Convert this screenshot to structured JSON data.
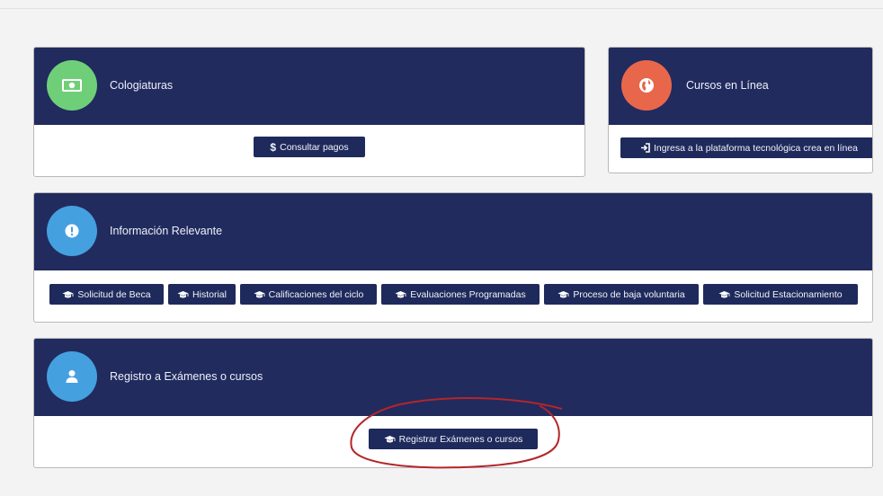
{
  "cards": {
    "colegiaturas": {
      "title": "Cologiaturas",
      "icon": "money-icon",
      "icon_color": "#6fcf78",
      "button": {
        "label": "Consultar pagos",
        "icon": "dollar-icon"
      }
    },
    "cursos": {
      "title": "Cursos en Línea",
      "icon": "globe-icon",
      "icon_color": "#e8674b",
      "button": {
        "label": "Ingresa a la plataforma tecnológica crea en línea",
        "icon": "sign-in-icon"
      }
    },
    "informacion": {
      "title": "Información Relevante",
      "icon": "exclamation-icon",
      "icon_color": "#45a0e0",
      "buttons": [
        {
          "label": "Solicitud de Beca",
          "icon": "graduation-cap-icon"
        },
        {
          "label": "Historial",
          "icon": "graduation-cap-icon"
        },
        {
          "label": "Calificaciones del ciclo",
          "icon": "graduation-cap-icon"
        },
        {
          "label": "Evaluaciones Programadas",
          "icon": "graduation-cap-icon"
        },
        {
          "label": "Proceso de baja voluntaria",
          "icon": "graduation-cap-icon"
        },
        {
          "label": "Solicitud Estacionamiento",
          "icon": "graduation-cap-icon"
        }
      ]
    },
    "registro": {
      "title": "Registro a Exámenes o cursos",
      "icon": "user-icon",
      "icon_color": "#45a0e0",
      "button": {
        "label": "Registrar Exámenes o cursos",
        "icon": "graduation-cap-icon"
      }
    }
  },
  "colors": {
    "header_bg": "#212b5e",
    "button_bg": "#1f2a5c",
    "highlight_ellipse": "#b3262b"
  }
}
